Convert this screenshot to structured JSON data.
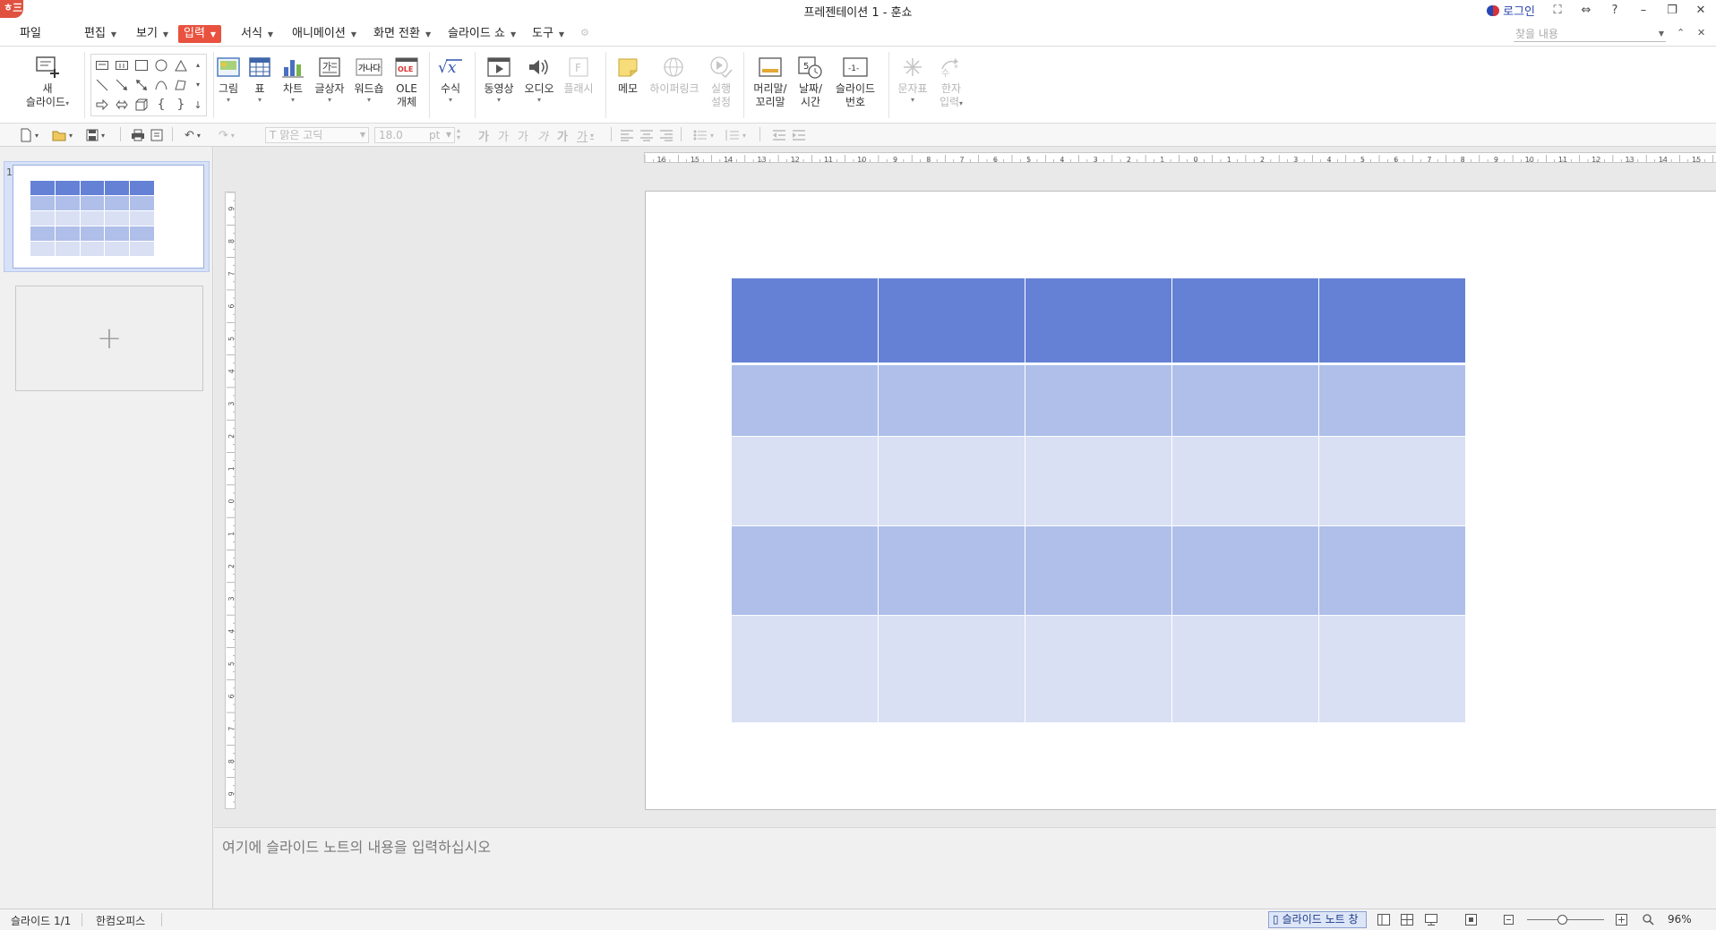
{
  "titlebar": {
    "logo": "ㅎ三",
    "title": "프레젠테이션 1 - 훈쇼",
    "login": "로그인",
    "buttons": [
      "⛶",
      "⇔",
      "?",
      "–",
      "❐",
      "✕"
    ]
  },
  "menubar": {
    "items": [
      {
        "label": "파일",
        "caret": false
      },
      {
        "label": "편집",
        "caret": true
      },
      {
        "label": "보기",
        "caret": true
      },
      {
        "label": "입력",
        "caret": true,
        "active": true
      },
      {
        "label": "서식",
        "caret": true
      },
      {
        "label": "애니메이션",
        "caret": true
      },
      {
        "label": "화면 전환",
        "caret": true
      },
      {
        "label": "슬라이드 쇼",
        "caret": true
      },
      {
        "label": "도구",
        "caret": true
      }
    ],
    "search_placeholder": "찾을 내용",
    "accent_color": "#e8523f"
  },
  "ribbon": {
    "new_slide": [
      "새",
      "슬라이드"
    ],
    "buttons": [
      {
        "id": "picture",
        "lines": [
          "그림"
        ],
        "icon": "picture-icon"
      },
      {
        "id": "table",
        "lines": [
          "표"
        ],
        "icon": "table-icon"
      },
      {
        "id": "chart",
        "lines": [
          "차트"
        ],
        "icon": "chart-icon"
      },
      {
        "id": "textbox",
        "lines": [
          "글상자"
        ],
        "icon": "textbox-icon"
      },
      {
        "id": "wordart",
        "lines": [
          "워드숍"
        ],
        "icon": "wordart-icon"
      },
      {
        "id": "ole",
        "lines": [
          "OLE",
          "개체"
        ],
        "icon": "ole-icon"
      },
      {
        "id": "equation",
        "lines": [
          "수식"
        ],
        "icon": "equation-icon"
      },
      {
        "id": "video",
        "lines": [
          "동영상"
        ],
        "icon": "video-icon"
      },
      {
        "id": "audio",
        "lines": [
          "오디오"
        ],
        "icon": "audio-icon"
      },
      {
        "id": "flash",
        "lines": [
          "플래시"
        ],
        "icon": "flash-icon",
        "disabled": true
      },
      {
        "id": "memo",
        "lines": [
          "메모"
        ],
        "icon": "memo-icon"
      },
      {
        "id": "hyperlink",
        "lines": [
          "하이퍼링크"
        ],
        "icon": "hyperlink-icon",
        "disabled": true
      },
      {
        "id": "action",
        "lines": [
          "실행",
          "설정"
        ],
        "icon": "action-icon",
        "disabled": true
      },
      {
        "id": "header-footer",
        "lines": [
          "머리말/",
          "꼬리말"
        ],
        "icon": "header-footer-icon"
      },
      {
        "id": "date-time",
        "lines": [
          "날짜/",
          "시간"
        ],
        "icon": "date-time-icon"
      },
      {
        "id": "slide-number",
        "lines": [
          "슬라이드",
          "번호"
        ],
        "icon": "slide-number-icon"
      },
      {
        "id": "symbol",
        "lines": [
          "문자표"
        ],
        "icon": "symbol-icon",
        "disabled": true
      },
      {
        "id": "hanja",
        "lines": [
          "한자",
          "입력"
        ],
        "icon": "hanja-icon",
        "disabled": true
      }
    ],
    "ole_label": "OLE",
    "date_icon_text": "5",
    "slide_number_icon_text": "-1-",
    "wordart_icon_text": "가나다"
  },
  "toolbar": {
    "font_name": "맑은 고딕",
    "font_size": "18.0",
    "font_unit": "pt",
    "font_prefix": "T"
  },
  "slides_panel": {
    "slide_number": "1",
    "add_symbol": "+"
  },
  "ruler": {
    "horizontal_labels": [
      "16",
      "15",
      "14",
      "13",
      "12",
      "11",
      "10",
      "9",
      "8",
      "7",
      "6",
      "5",
      "4",
      "3",
      "2",
      "1",
      "0",
      "1",
      "2",
      "3",
      "4",
      "5",
      "6",
      "7",
      "8",
      "9",
      "10",
      "11",
      "12",
      "13",
      "14",
      "15",
      "16"
    ],
    "vertical_labels": [
      "9",
      "8",
      "7",
      "6",
      "5",
      "4",
      "3",
      "2",
      "1",
      "0",
      "1",
      "2",
      "3",
      "4",
      "5",
      "6",
      "7",
      "8",
      "9"
    ]
  },
  "slide": {
    "table": {
      "rows": 5,
      "cols": 5,
      "row_colors": [
        "#6581d6",
        "#afbfea",
        "#d9e0f4",
        "#afbfea",
        "#d9e0f4"
      ]
    }
  },
  "notes": {
    "placeholder": "여기에 슬라이드 노트의 내용을 입력하십시오"
  },
  "statusbar": {
    "slide_info": "슬라이드 1/1",
    "app_name": "한컴오피스",
    "notes_toggle": "슬라이드 노트 창",
    "zoom_level": "96%"
  }
}
